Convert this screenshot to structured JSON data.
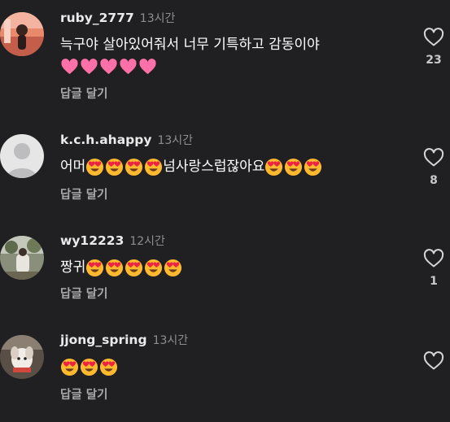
{
  "comments": [
    {
      "username": "ruby_2777",
      "time": "13시간",
      "text": "늑구야 살아있어줘서 너무 기특하고 감동이야",
      "emoji": "pink-heart",
      "emoji_count": 5,
      "reply_label": "답글 달기",
      "likes": "23",
      "avatar": "photo-avatar"
    },
    {
      "username": "k.c.h.ahappy",
      "time": "13시간",
      "text_before": "어머",
      "emoji_before_count": 4,
      "text_after": "넘사랑스럽잖아요",
      "emoji_after_count": 3,
      "emoji": "heart-eyes-face",
      "reply_label": "답글 달기",
      "likes": "8",
      "avatar": "default-avatar"
    },
    {
      "username": "wy12223",
      "time": "12시간",
      "text": "짱귀",
      "emoji": "heart-eyes-face",
      "emoji_count": 5,
      "reply_label": "답글 달기",
      "likes": "1",
      "avatar": "photo-avatar"
    },
    {
      "username": "jjong_spring",
      "time": "13시간",
      "text": "",
      "emoji": "heart-eyes-face",
      "emoji_count": 3,
      "reply_label": "답글 달기",
      "likes": "",
      "avatar": "photo-avatar"
    }
  ],
  "colors": {
    "background": "#202022",
    "text": "#ffffff",
    "muted": "#8e8e92",
    "pink_heart": "#ff6fa8",
    "face": "#ffb92e",
    "heart_eye": "#ee2344"
  }
}
